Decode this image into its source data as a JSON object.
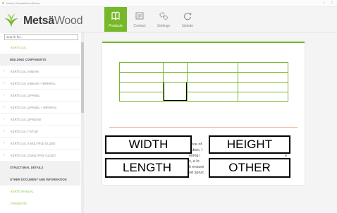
{
  "window": {
    "title": "Metsä | MetsäWood Books",
    "controls": [
      "–",
      "□"
    ]
  },
  "brand": {
    "word_main": "Metsä",
    "word_wood": "Wood",
    "accent": "#76b82a"
  },
  "nav": [
    {
      "label": "Products",
      "icon": "book-icon",
      "active": true
    },
    {
      "label": "Contact",
      "icon": "contact-card-icon",
      "active": false
    },
    {
      "label": "Settings",
      "icon": "gears-icon",
      "active": false
    },
    {
      "label": "Update",
      "icon": "refresh-icon",
      "active": false
    }
  ],
  "search": {
    "placeholder": "search for..."
  },
  "sidebar": {
    "items": [
      {
        "label": "KERTO LVL",
        "kind": "green"
      },
      {
        "label": "BUILDING COMPONENTS",
        "kind": "section"
      },
      {
        "label": "KERTO LVL S-BEAM",
        "kind": "item"
      },
      {
        "label": "KERTO LVL S-BEAM – IMPERIAL",
        "kind": "item"
      },
      {
        "label": "KERTO LVL Q-PANEL",
        "kind": "item"
      },
      {
        "label": "KERTO LVL Q-PANEL – IMPERIAL",
        "kind": "item"
      },
      {
        "label": "KERTO LVL QP-BEAM",
        "kind": "item"
      },
      {
        "label": "KERTO LVL T-STUD",
        "kind": "item"
      },
      {
        "label": "KERTO LVL S MULTIPLE GLUED",
        "kind": "item"
      },
      {
        "label": "KERTO LVL Q MULTIPLE GLUED",
        "kind": "item"
      },
      {
        "label": "STRUCTURAL DETAILS",
        "kind": "section"
      },
      {
        "label": "OTHER DOCUMENT AND INFORMATION",
        "kind": "section"
      },
      {
        "label": "KERTO MANUAL",
        "kind": "green"
      },
      {
        "label": "FINNWOOD",
        "kind": "green"
      }
    ]
  },
  "document": {
    "paragraph": [
      "ance of",
      "uction, I",
      "ening i",
      "s, a lo",
      "h ensure",
      "ed spruc"
    ],
    "paragraph_right": [
      "",
      "",
      "e",
      "",
      "r",
      "d"
    ]
  },
  "overlay": {
    "width": "WIDTH",
    "height": "HEIGHT",
    "length": "LENGTH",
    "other": "OTHER"
  }
}
